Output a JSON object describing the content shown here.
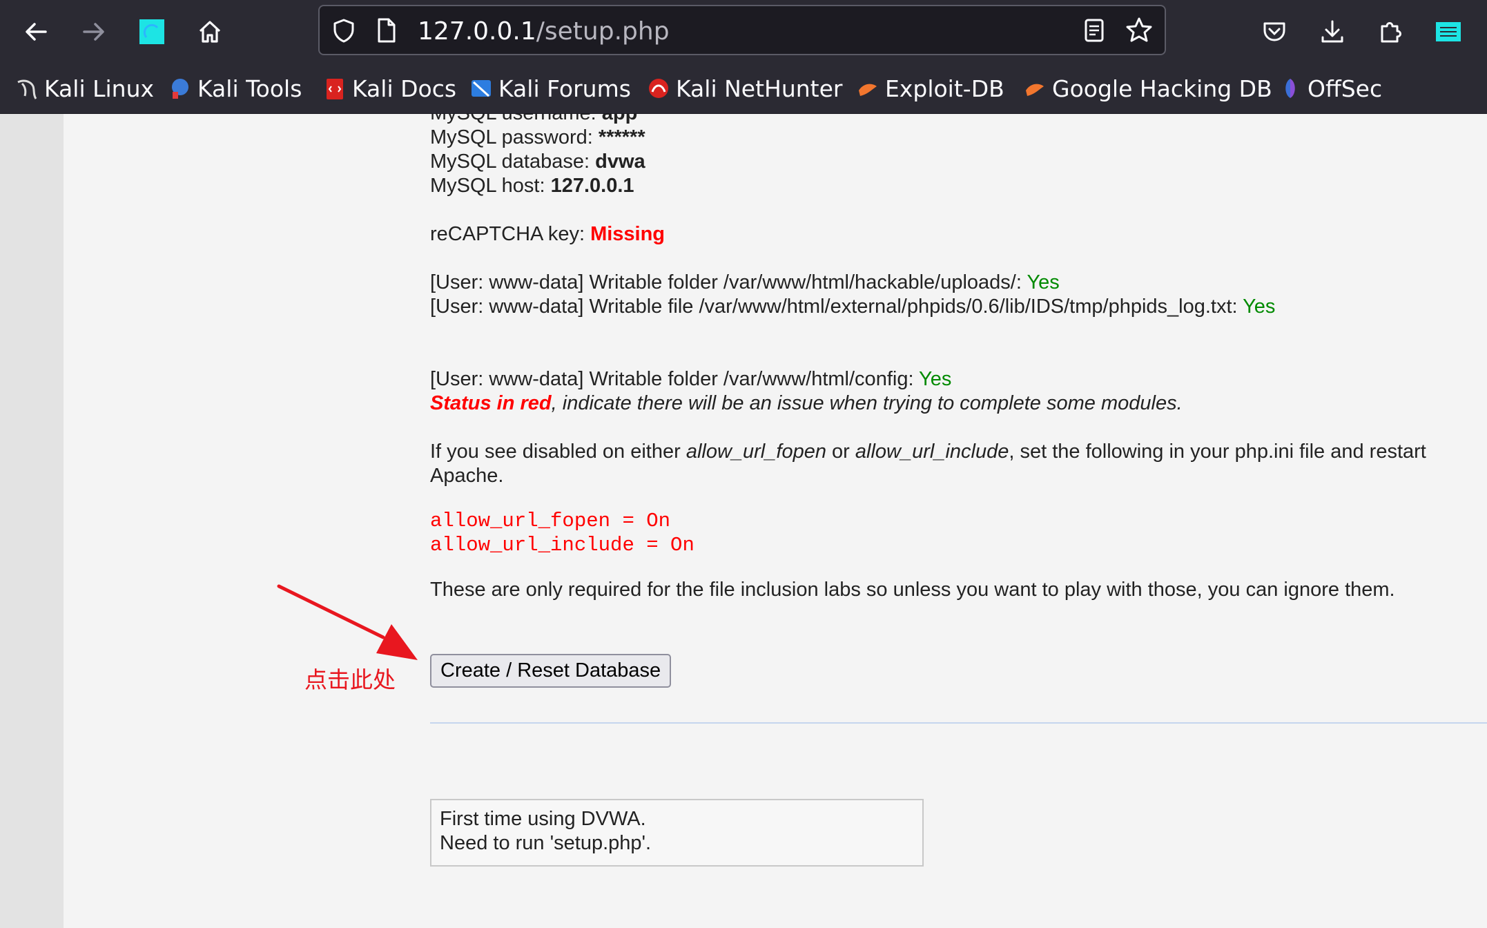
{
  "browser": {
    "url_host": "127.0.0.1",
    "url_path": "/setup.php",
    "bookmarks": [
      {
        "label": "Kali Linux",
        "icon": "kali-dragon-icon"
      },
      {
        "label": "Kali Tools",
        "icon": "kali-tools-icon"
      },
      {
        "label": "Kali Docs",
        "icon": "kali-docs-icon"
      },
      {
        "label": "Kali Forums",
        "icon": "kali-forums-icon"
      },
      {
        "label": "Kali NetHunter",
        "icon": "kali-nethunter-icon"
      },
      {
        "label": "Exploit-DB",
        "icon": "exploit-db-icon"
      },
      {
        "label": "Google Hacking DB",
        "icon": "ghdb-icon"
      },
      {
        "label": "OffSec",
        "icon": "offsec-icon"
      }
    ]
  },
  "setup": {
    "username_label": "MySQL username: ",
    "username_value": "app",
    "password_label": "MySQL password: ",
    "password_value": "******",
    "database_label": "MySQL database: ",
    "database_value": "dvwa",
    "host_label": "MySQL host: ",
    "host_value": "127.0.0.1",
    "recaptcha_label": "reCAPTCHA key: ",
    "recaptcha_value": "Missing",
    "uploads_text": "[User: www-data] Writable folder /var/www/html/hackable/uploads/: ",
    "uploads_status": "Yes",
    "phpids_text": "[User: www-data] Writable file /var/www/html/external/phpids/0.6/lib/IDS/tmp/phpids_log.txt: ",
    "phpids_status": "Yes",
    "config_text": "[User: www-data] Writable folder /var/www/html/config: ",
    "config_status": "Yes",
    "status_red_bold": "Status in red",
    "status_red_rest": ", indicate there will be an issue when trying to complete some modules.",
    "disabled_p1": "If you see disabled on either ",
    "disabled_opt1": "allow_url_fopen",
    "disabled_or": " or ",
    "disabled_opt2": "allow_url_include",
    "disabled_p2": ", set the following in your php.ini file and restart",
    "disabled_p3": "Apache.",
    "code_line1": "allow_url_fopen = On",
    "code_line2": "allow_url_include = On",
    "required_note": "These are only required for the file inclusion labs so unless you want to play with those, you can ignore them.",
    "create_button": "Create / Reset Database",
    "info_line1": "First time using DVWA.",
    "info_line2": "Need to run 'setup.php'."
  },
  "annotation": {
    "text": "点击此处",
    "color": "#e8171f"
  }
}
